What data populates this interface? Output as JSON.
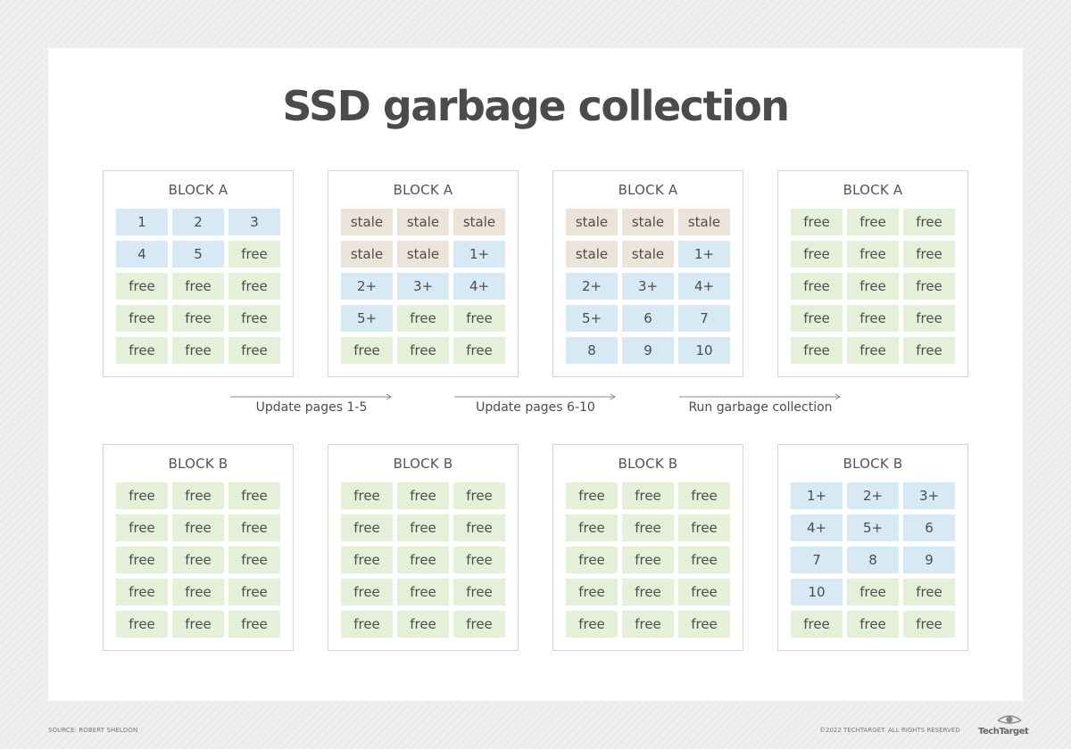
{
  "title": "SSD garbage collection",
  "steps": [
    "Update pages 1-5",
    "Update pages 6-10",
    "Run garbage collection"
  ],
  "rows": [
    {
      "blocks": [
        {
          "label": "BLOCK A",
          "cells": [
            {
              "text": "1",
              "type": "used"
            },
            {
              "text": "2",
              "type": "used"
            },
            {
              "text": "3",
              "type": "used"
            },
            {
              "text": "4",
              "type": "used"
            },
            {
              "text": "5",
              "type": "used"
            },
            {
              "text": "free",
              "type": "free"
            },
            {
              "text": "free",
              "type": "free"
            },
            {
              "text": "free",
              "type": "free"
            },
            {
              "text": "free",
              "type": "free"
            },
            {
              "text": "free",
              "type": "free"
            },
            {
              "text": "free",
              "type": "free"
            },
            {
              "text": "free",
              "type": "free"
            },
            {
              "text": "free",
              "type": "free"
            },
            {
              "text": "free",
              "type": "free"
            },
            {
              "text": "free",
              "type": "free"
            }
          ]
        },
        {
          "label": "BLOCK A",
          "cells": [
            {
              "text": "stale",
              "type": "stale"
            },
            {
              "text": "stale",
              "type": "stale"
            },
            {
              "text": "stale",
              "type": "stale"
            },
            {
              "text": "stale",
              "type": "stale"
            },
            {
              "text": "stale",
              "type": "stale"
            },
            {
              "text": "1+",
              "type": "used"
            },
            {
              "text": "2+",
              "type": "used"
            },
            {
              "text": "3+",
              "type": "used"
            },
            {
              "text": "4+",
              "type": "used"
            },
            {
              "text": "5+",
              "type": "used"
            },
            {
              "text": "free",
              "type": "free"
            },
            {
              "text": "free",
              "type": "free"
            },
            {
              "text": "free",
              "type": "free"
            },
            {
              "text": "free",
              "type": "free"
            },
            {
              "text": "free",
              "type": "free"
            }
          ]
        },
        {
          "label": "BLOCK A",
          "cells": [
            {
              "text": "stale",
              "type": "stale"
            },
            {
              "text": "stale",
              "type": "stale"
            },
            {
              "text": "stale",
              "type": "stale"
            },
            {
              "text": "stale",
              "type": "stale"
            },
            {
              "text": "stale",
              "type": "stale"
            },
            {
              "text": "1+",
              "type": "used"
            },
            {
              "text": "2+",
              "type": "used"
            },
            {
              "text": "3+",
              "type": "used"
            },
            {
              "text": "4+",
              "type": "used"
            },
            {
              "text": "5+",
              "type": "used"
            },
            {
              "text": "6",
              "type": "used"
            },
            {
              "text": "7",
              "type": "used"
            },
            {
              "text": "8",
              "type": "used"
            },
            {
              "text": "9",
              "type": "used"
            },
            {
              "text": "10",
              "type": "used"
            }
          ]
        },
        {
          "label": "BLOCK A",
          "cells": [
            {
              "text": "free",
              "type": "free"
            },
            {
              "text": "free",
              "type": "free"
            },
            {
              "text": "free",
              "type": "free"
            },
            {
              "text": "free",
              "type": "free"
            },
            {
              "text": "free",
              "type": "free"
            },
            {
              "text": "free",
              "type": "free"
            },
            {
              "text": "free",
              "type": "free"
            },
            {
              "text": "free",
              "type": "free"
            },
            {
              "text": "free",
              "type": "free"
            },
            {
              "text": "free",
              "type": "free"
            },
            {
              "text": "free",
              "type": "free"
            },
            {
              "text": "free",
              "type": "free"
            },
            {
              "text": "free",
              "type": "free"
            },
            {
              "text": "free",
              "type": "free"
            },
            {
              "text": "free",
              "type": "free"
            }
          ]
        }
      ]
    },
    {
      "blocks": [
        {
          "label": "BLOCK B",
          "cells": [
            {
              "text": "free",
              "type": "free"
            },
            {
              "text": "free",
              "type": "free"
            },
            {
              "text": "free",
              "type": "free"
            },
            {
              "text": "free",
              "type": "free"
            },
            {
              "text": "free",
              "type": "free"
            },
            {
              "text": "free",
              "type": "free"
            },
            {
              "text": "free",
              "type": "free"
            },
            {
              "text": "free",
              "type": "free"
            },
            {
              "text": "free",
              "type": "free"
            },
            {
              "text": "free",
              "type": "free"
            },
            {
              "text": "free",
              "type": "free"
            },
            {
              "text": "free",
              "type": "free"
            },
            {
              "text": "free",
              "type": "free"
            },
            {
              "text": "free",
              "type": "free"
            },
            {
              "text": "free",
              "type": "free"
            }
          ]
        },
        {
          "label": "BLOCK B",
          "cells": [
            {
              "text": "free",
              "type": "free"
            },
            {
              "text": "free",
              "type": "free"
            },
            {
              "text": "free",
              "type": "free"
            },
            {
              "text": "free",
              "type": "free"
            },
            {
              "text": "free",
              "type": "free"
            },
            {
              "text": "free",
              "type": "free"
            },
            {
              "text": "free",
              "type": "free"
            },
            {
              "text": "free",
              "type": "free"
            },
            {
              "text": "free",
              "type": "free"
            },
            {
              "text": "free",
              "type": "free"
            },
            {
              "text": "free",
              "type": "free"
            },
            {
              "text": "free",
              "type": "free"
            },
            {
              "text": "free",
              "type": "free"
            },
            {
              "text": "free",
              "type": "free"
            },
            {
              "text": "free",
              "type": "free"
            }
          ]
        },
        {
          "label": "BLOCK B",
          "cells": [
            {
              "text": "free",
              "type": "free"
            },
            {
              "text": "free",
              "type": "free"
            },
            {
              "text": "free",
              "type": "free"
            },
            {
              "text": "free",
              "type": "free"
            },
            {
              "text": "free",
              "type": "free"
            },
            {
              "text": "free",
              "type": "free"
            },
            {
              "text": "free",
              "type": "free"
            },
            {
              "text": "free",
              "type": "free"
            },
            {
              "text": "free",
              "type": "free"
            },
            {
              "text": "free",
              "type": "free"
            },
            {
              "text": "free",
              "type": "free"
            },
            {
              "text": "free",
              "type": "free"
            },
            {
              "text": "free",
              "type": "free"
            },
            {
              "text": "free",
              "type": "free"
            },
            {
              "text": "free",
              "type": "free"
            }
          ]
        },
        {
          "label": "BLOCK B",
          "cells": [
            {
              "text": "1+",
              "type": "used"
            },
            {
              "text": "2+",
              "type": "used"
            },
            {
              "text": "3+",
              "type": "used"
            },
            {
              "text": "4+",
              "type": "used"
            },
            {
              "text": "5+",
              "type": "used"
            },
            {
              "text": "6",
              "type": "used"
            },
            {
              "text": "7",
              "type": "used"
            },
            {
              "text": "8",
              "type": "used"
            },
            {
              "text": "9",
              "type": "used"
            },
            {
              "text": "10",
              "type": "used"
            },
            {
              "text": "free",
              "type": "free"
            },
            {
              "text": "free",
              "type": "free"
            },
            {
              "text": "free",
              "type": "free"
            },
            {
              "text": "free",
              "type": "free"
            },
            {
              "text": "free",
              "type": "free"
            }
          ]
        }
      ]
    }
  ],
  "colors": {
    "free": "#e4f0d8",
    "used": "#d6e9f4",
    "stale": "#ede4d9",
    "arrow": "#8a8a8a"
  },
  "icons": {
    "logo": "techtarget-eye-icon",
    "arrow": "arrow-right-icon"
  },
  "footer": {
    "source": "SOURCE: ROBERT SHELDON",
    "copyright": "©2022 TECHTARGET. ALL RIGHTS RESERVED",
    "brand": "TechTarget"
  }
}
